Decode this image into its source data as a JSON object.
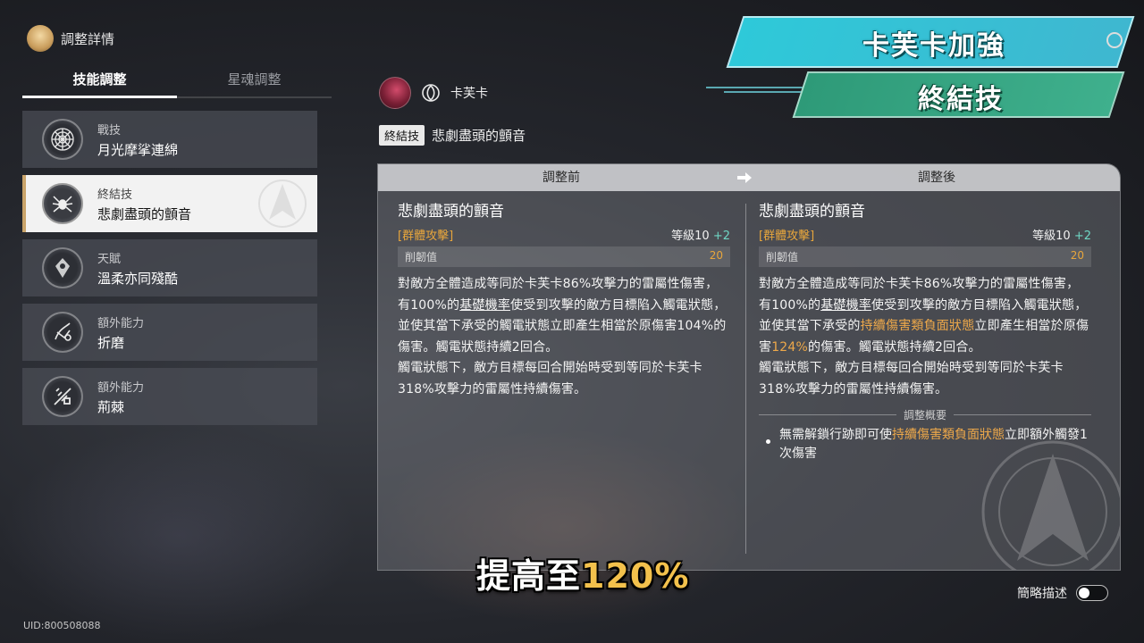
{
  "header": {
    "title": "調整詳情"
  },
  "tabs": [
    {
      "label": "技能調整",
      "active": true
    },
    {
      "label": "星魂調整",
      "active": false
    }
  ],
  "skills": [
    {
      "type": "戰技",
      "name": "月光摩挲連綿",
      "icon": "web-icon"
    },
    {
      "type": "終結技",
      "name": "悲劇盡頭的顫音",
      "icon": "spider-icon",
      "active": true
    },
    {
      "type": "天賦",
      "name": "溫柔亦同殘酷",
      "icon": "talent-icon"
    },
    {
      "type": "額外能力",
      "name": "折磨",
      "icon": "torment-icon"
    },
    {
      "type": "額外能力",
      "name": "荊棘",
      "icon": "thorns-icon"
    }
  ],
  "uid": "UID:800508088",
  "character": {
    "name": "卡芙卡",
    "path_icon": "nihility-path-icon"
  },
  "skill_heading": {
    "type_tag": "終結技",
    "name": "悲劇盡頭的顫音"
  },
  "compare": {
    "before_label": "調整前",
    "after_label": "調整後",
    "before": {
      "title": "悲劇盡頭的顫音",
      "tag": "[群體攻擊]",
      "level_text": "等級10",
      "level_bonus": "+2",
      "toughness_label": "削韌值",
      "toughness_value": "20",
      "d1": "對敵方全體造成等同於卡芙卡86%攻擊力的雷屬性傷害，有100%的",
      "d2": "基礎機率",
      "d3": "使受到攻擊的敵方目標陷入觸電狀態，並使其當下承受的觸電狀態立即產生相當於原傷害104%的傷害。觸電狀態持續2回合。",
      "d4": "觸電狀態下，敵方目標每回合開始時受到等同於卡芙卡318%攻擊力的雷屬性持續傷害。"
    },
    "after": {
      "title": "悲劇盡頭的顫音",
      "tag": "[群體攻擊]",
      "level_text": "等級10",
      "level_bonus": "+2",
      "toughness_label": "削韌值",
      "toughness_value": "20",
      "d1": "對敵方全體造成等同於卡芙卡86%攻擊力的雷屬性傷害，有100%的",
      "d2": "基礎機率",
      "d3": "使受到攻擊的敵方目標陷入觸電狀態，並使其當下承受的",
      "d4": "持續傷害類負面狀態",
      "d5": "立即產生相當於原傷害",
      "d6": "124%",
      "d7": "的傷害。觸電狀態持續2回合。",
      "d8": "觸電狀態下，敵方目標每回合開始時受到等同於卡芙卡318%攻擊力的雷屬性持續傷害。",
      "summary_title": "調整概要",
      "s1": "無需解鎖行跡即可使",
      "s2": "持續傷害類負面狀態",
      "s3": "立即額外觸發1次傷害"
    }
  },
  "banner": {
    "top": "卡芙卡加強",
    "bottom": "終結技"
  },
  "subtitle": {
    "prefix": "提高至",
    "value": "120%"
  },
  "toggle": {
    "label": "簡略描述",
    "on": false
  },
  "colors": {
    "highlight": "#eda84a",
    "bonus": "#6fd6c4",
    "banner_top": "#2ec9d9",
    "banner_bottom": "#2e9a78"
  }
}
